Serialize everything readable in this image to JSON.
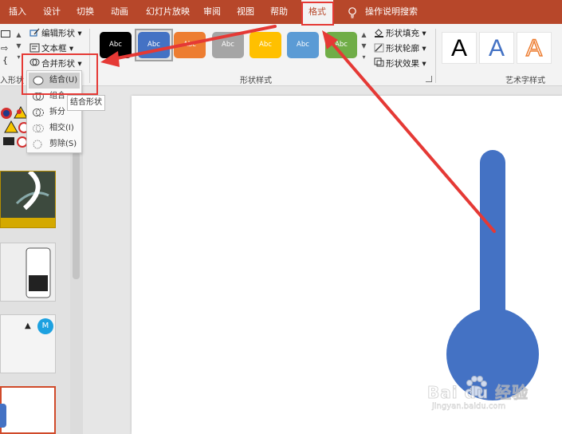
{
  "tabs": [
    {
      "label": "插入",
      "active": false
    },
    {
      "label": "设计",
      "active": false
    },
    {
      "label": "切换",
      "active": false
    },
    {
      "label": "动画",
      "active": false
    },
    {
      "label": "幻灯片放映",
      "active": false
    },
    {
      "label": "审阅",
      "active": false
    },
    {
      "label": "视图",
      "active": false
    },
    {
      "label": "帮助",
      "active": false
    },
    {
      "label": "格式",
      "active": true
    },
    {
      "label": "操作说明搜索",
      "active": false
    }
  ],
  "ribbon": {
    "insert_shapes_group_label": "入形状",
    "edit_shape_label": "编辑形状",
    "text_box_label": "文本框",
    "merge_shapes_label": "合并形状",
    "shape_styles_group_label": "形状样式",
    "shape_fill_label": "形状填充",
    "shape_outline_label": "形状轮廓",
    "shape_effects_label": "形状效果",
    "wordart_group_label": "艺术字样式",
    "style_swatches": [
      {
        "text": "Abc",
        "color": "#000000"
      },
      {
        "text": "Abc",
        "color": "#4472c4",
        "selected": true
      },
      {
        "text": "Abc",
        "color": "#ed7d31"
      },
      {
        "text": "Abc",
        "color": "#a5a5a5"
      },
      {
        "text": "Abc",
        "color": "#ffc000"
      },
      {
        "text": "Abc",
        "color": "#5b9bd5"
      },
      {
        "text": "Abc",
        "color": "#70ad47"
      }
    ],
    "wordart_samples": [
      {
        "text": "A",
        "style": "black"
      },
      {
        "text": "A",
        "style": "blue"
      },
      {
        "text": "A",
        "style": "orange-outline"
      }
    ]
  },
  "merge_menu": {
    "items": [
      {
        "label": "结合(U)",
        "hover": true
      },
      {
        "label": "组合",
        "hover": false
      },
      {
        "label": "拆分",
        "hover": false
      },
      {
        "label": "相交(I)",
        "hover": false
      },
      {
        "label": "剪除(S)",
        "hover": false
      }
    ],
    "tooltip": "结合形状"
  },
  "slide_badge": "M",
  "watermark": {
    "brand": "Bai du 经验",
    "url": "jingyan.baidu.com"
  },
  "colors": {
    "accent": "#b7472a",
    "shape_fill": "#4472c4",
    "annotation": "#e53935"
  }
}
